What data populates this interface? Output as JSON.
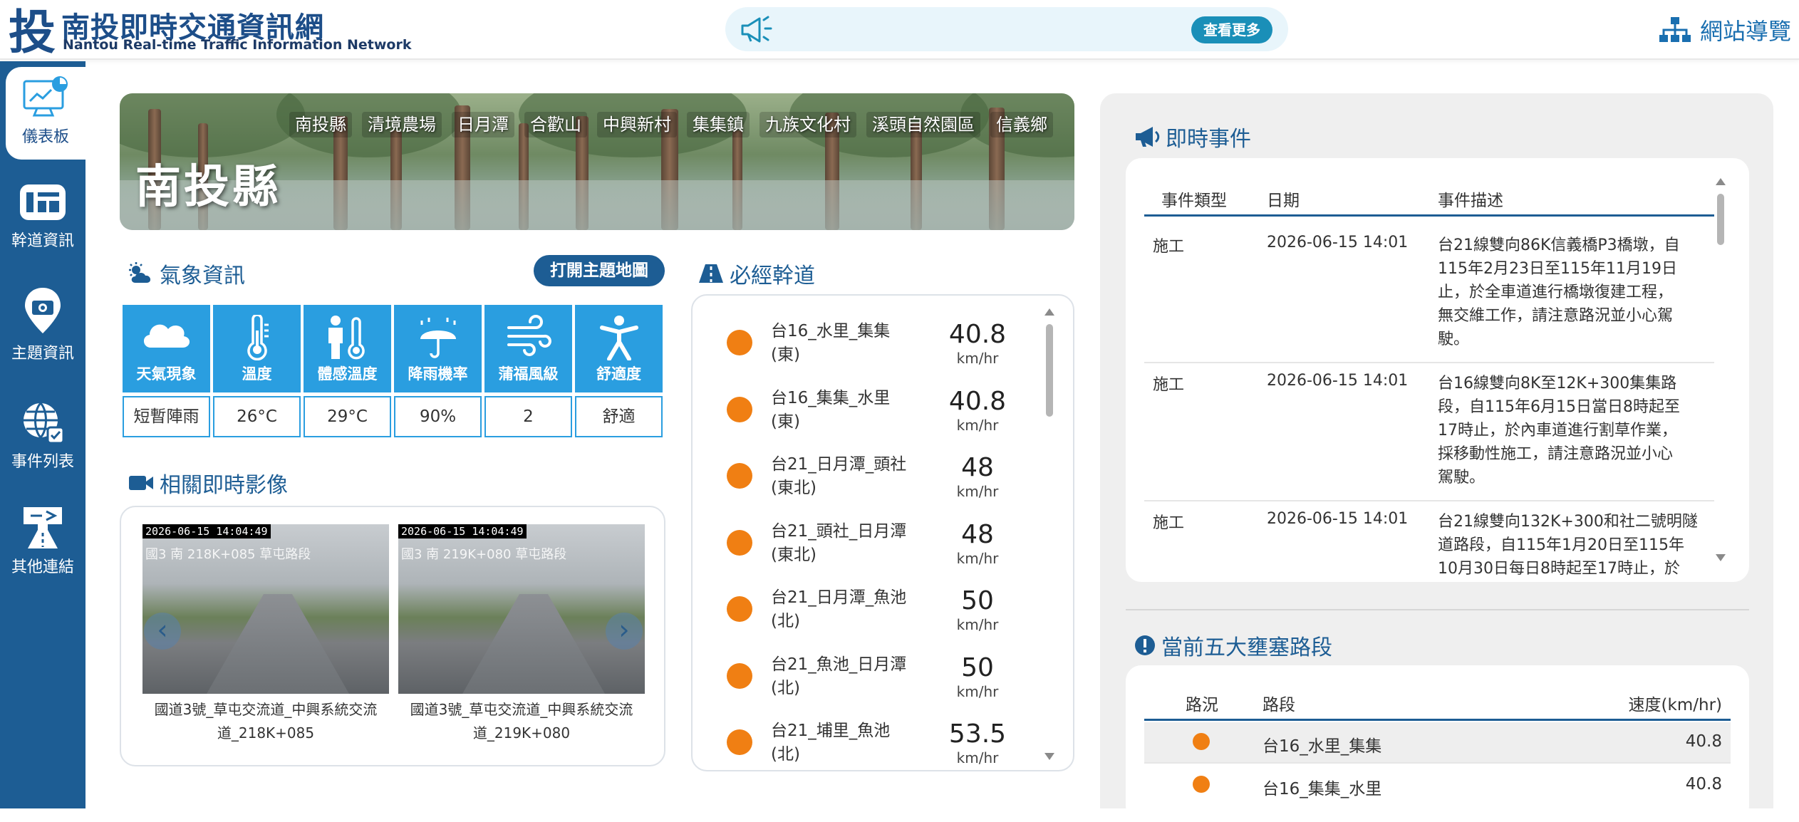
{
  "header": {
    "logo_char": "投",
    "title_zh": "南投即時交通資訊網",
    "title_en": "Nantou Real-time Traffic Information Network",
    "announce_more": "查看更多",
    "sitemap": "網站導覽"
  },
  "sidebar": {
    "items": [
      {
        "label": "儀表板",
        "icon": "dashboard-icon",
        "active": true
      },
      {
        "label": "幹道資訊",
        "icon": "road-info-icon"
      },
      {
        "label": "主題資訊",
        "icon": "location-camera-icon"
      },
      {
        "label": "事件列表",
        "icon": "globe-event-icon"
      },
      {
        "label": "其他連結",
        "icon": "road-sign-icon"
      }
    ]
  },
  "banner": {
    "title": "南投縣",
    "tabs": [
      "南投縣",
      "清境農場",
      "日月潭",
      "合歡山",
      "中興新村",
      "集集鎮",
      "九族文化村",
      "溪頭自然園區",
      "信義鄉"
    ]
  },
  "weather": {
    "title": "氣象資訊",
    "theme_map_button": "打開主題地圖",
    "items": [
      {
        "label": "天氣現象",
        "value": "短暫陣雨",
        "icon": "cloud-icon"
      },
      {
        "label": "溫度",
        "value": "26°C",
        "icon": "thermometer-icon"
      },
      {
        "label": "體感溫度",
        "value": "29°C",
        "icon": "person-temp-icon"
      },
      {
        "label": "降雨機率",
        "value": "90%",
        "icon": "umbrella-rain-icon"
      },
      {
        "label": "蒲福風級",
        "value": "2",
        "icon": "wind-icon"
      },
      {
        "label": "舒適度",
        "value": "舒適",
        "icon": "person-icon"
      }
    ]
  },
  "cameras": {
    "title": "相關即時影像",
    "items": [
      {
        "timestamp": "2026-06-15 14:04:49",
        "overlay": "國3 南 218K+085 草屯路段",
        "caption_1": "國道3號_草屯交流道_中興系統交流",
        "caption_2": "道_218K+085"
      },
      {
        "timestamp": "2026-06-15 14:04:49",
        "overlay": "國3 南 219K+080 草屯路段",
        "caption_1": "國道3號_草屯交流道_中興系統交流",
        "caption_2": "道_219K+080"
      }
    ]
  },
  "roads": {
    "title": "必經幹道",
    "unit": "km/hr",
    "items": [
      {
        "name": "台16_水里_集集",
        "dir": "(東)",
        "speed": "40.8",
        "status_color": "#f07f13"
      },
      {
        "name": "台16_集集_水里",
        "dir": "(東)",
        "speed": "40.8",
        "status_color": "#f07f13"
      },
      {
        "name": "台21_日月潭_頭社",
        "dir": "(東北)",
        "speed": "48",
        "status_color": "#f07f13"
      },
      {
        "name": "台21_頭社_日月潭",
        "dir": "(東北)",
        "speed": "48",
        "status_color": "#f07f13"
      },
      {
        "name": "台21_日月潭_魚池",
        "dir": "(北)",
        "speed": "50",
        "status_color": "#f07f13"
      },
      {
        "name": "台21_魚池_日月潭",
        "dir": "(北)",
        "speed": "50",
        "status_color": "#f07f13"
      },
      {
        "name": "台21_埔里_魚池",
        "dir": "(北)",
        "speed": "53.5",
        "status_color": "#f07f13"
      }
    ]
  },
  "events": {
    "title": "即時事件",
    "headers": [
      "事件類型",
      "日期",
      "事件描述"
    ],
    "rows": [
      {
        "type": "施工",
        "date": "2026-06-15 14:01",
        "desc": [
          "台21線雙向86K信義橋P3橋墩，自",
          "115年2月23日至115年11月19日",
          "止，於全車道進行橋墩復建工程，",
          "無交維工作，請注意路況並小心駕",
          "駛。"
        ]
      },
      {
        "type": "施工",
        "date": "2026-06-15 14:01",
        "desc": [
          "台16線雙向8K至12K+300集集路",
          "段，自115年6月15日當日8時起至",
          "17時止，於內車道進行割草作業，",
          "採移動性施工，請注意路況並小心",
          "駕駛。"
        ]
      },
      {
        "type": "施工",
        "date": "2026-06-15 14:01",
        "desc": [
          "台21線雙向132K+300和社二號明隧",
          "道路段，自115年1月20日至115年",
          "10月30日每日8時起至17時止，於"
        ]
      }
    ]
  },
  "congestion": {
    "title": "當前五大壅塞路段",
    "headers": [
      "路況",
      "路段",
      "速度(km/hr)"
    ],
    "rows": [
      {
        "road": "台16_水里_集集",
        "speed": "40.8",
        "status_color": "#f07f13"
      },
      {
        "road": "台16_集集_水里",
        "speed": "40.8",
        "status_color": "#f07f13"
      }
    ]
  },
  "colors": {
    "brand_blue": "#1d5d94",
    "weather_blue": "#2a9ee0",
    "accent_teal": "#1a8fb8",
    "status_orange": "#f07f13"
  }
}
